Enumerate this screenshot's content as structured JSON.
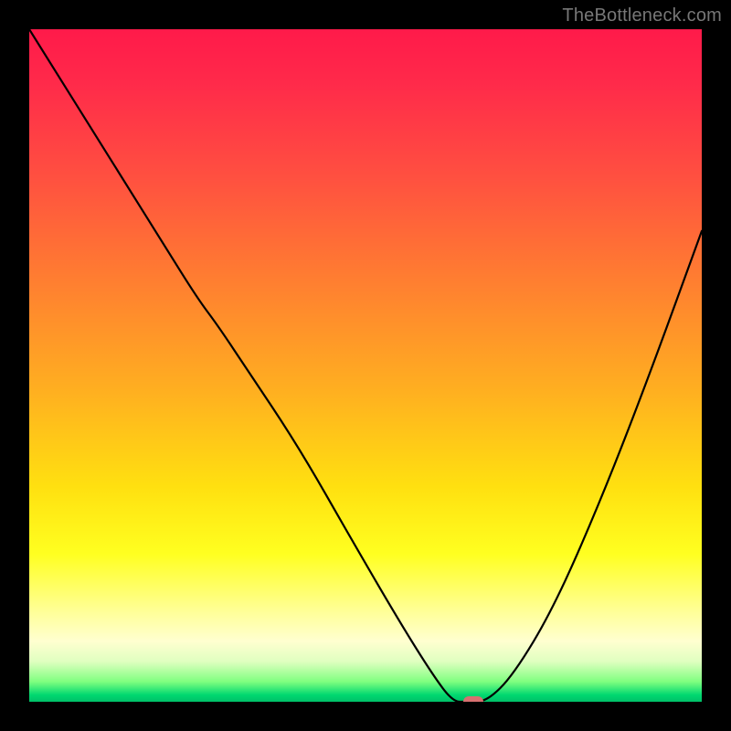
{
  "watermark": "TheBottleneck.com",
  "chart_data": {
    "type": "line",
    "title": "",
    "xlabel": "",
    "ylabel": "",
    "xlim": [
      0,
      100
    ],
    "ylim": [
      0,
      100
    ],
    "grid": false,
    "background": "gradient-red-to-green-vertical",
    "series": [
      {
        "name": "bottleneck-curve",
        "color": "#000000",
        "x": [
          0,
          5,
          10,
          15,
          20,
          25,
          28,
          32,
          40,
          48,
          55,
          60,
          63,
          65,
          68,
          72,
          78,
          85,
          92,
          100
        ],
        "y": [
          100,
          92,
          84,
          76,
          68,
          60,
          56,
          50,
          38,
          24,
          12,
          4,
          0,
          0,
          0,
          4,
          14,
          30,
          48,
          70
        ]
      }
    ],
    "marker": {
      "x": 66,
      "y": 0,
      "color": "#d87070"
    },
    "colors": {
      "bad": "#ff1a4a",
      "mid": "#ffe010",
      "good": "#00c068",
      "frame": "#000000"
    }
  }
}
